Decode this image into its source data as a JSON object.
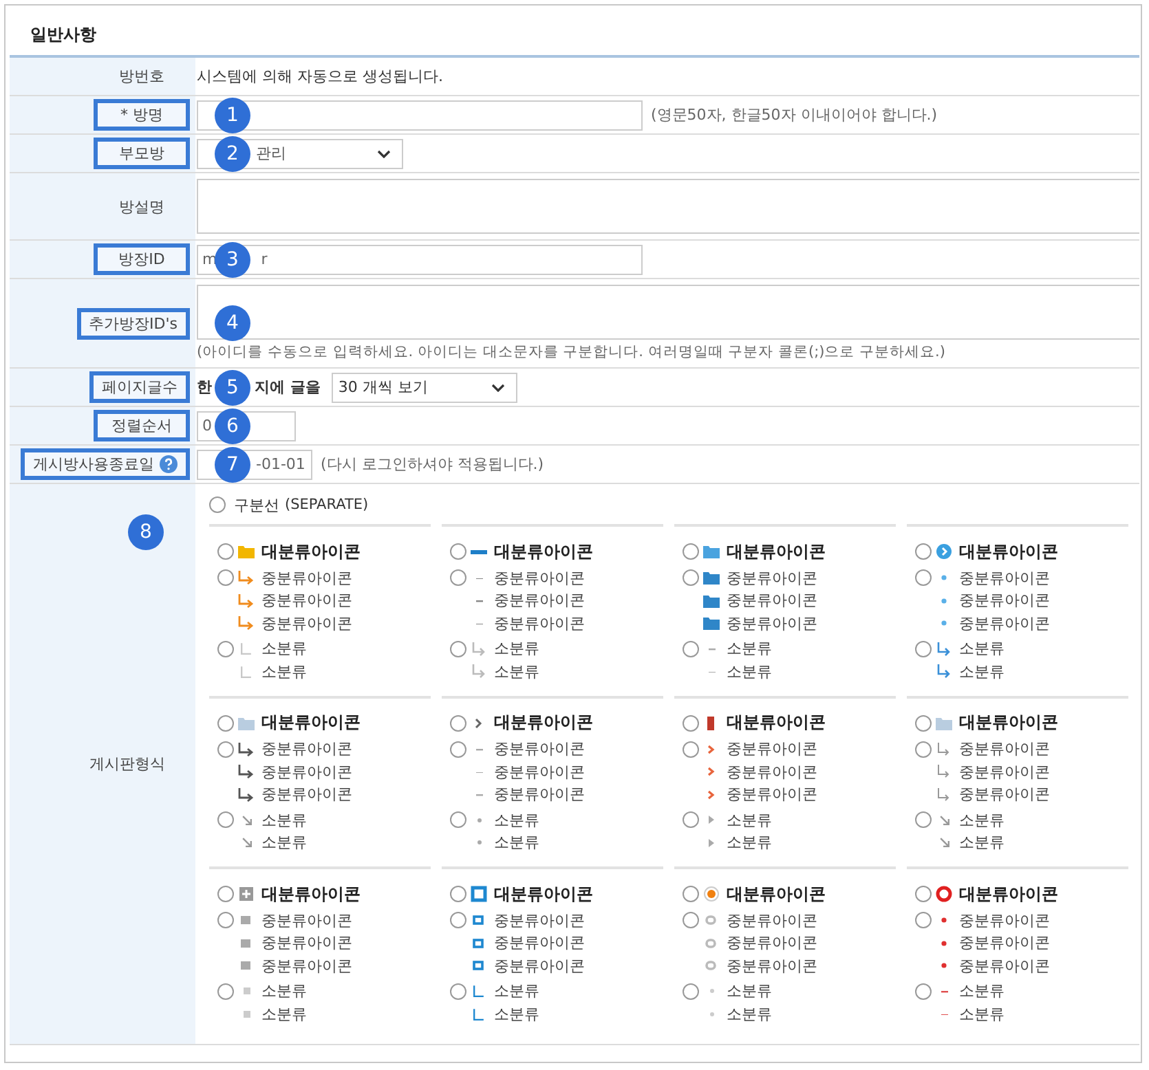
{
  "section_title": "일반사항",
  "rows": [
    {
      "label": "방번호",
      "highlighted": false,
      "kind": "static",
      "text": "시스템에 의해 자동으로 생성됩니다."
    },
    {
      "label": "* 방명",
      "highlighted": true,
      "badge": "1",
      "kind": "input",
      "hint": "(영문50자, 한글50자 이내이어야 합니다.)"
    },
    {
      "label": "부모방",
      "highlighted": true,
      "badge": "2",
      "kind": "select",
      "covered_start": true,
      "value_parts": [
        "관리"
      ]
    },
    {
      "label": "방설명",
      "highlighted": false,
      "kind": "textarea"
    },
    {
      "label": "방장ID",
      "highlighted": true,
      "badge": "3",
      "kind": "input",
      "value_parts": [
        "m",
        "r"
      ]
    },
    {
      "label": "추가방장ID's",
      "highlighted": true,
      "badge": "4",
      "kind": "textarea",
      "hint": "(아이디를 수동으로 입력하세요. 아이디는 대소문자를 구분합니다. 여러명일때 구분자 콜론(;)으로 구분하세요.)"
    },
    {
      "label": "페이지글수",
      "highlighted": true,
      "badge": "5",
      "kind": "page_count",
      "value_parts": [
        "한",
        "지에 글을"
      ],
      "select": "30 개씩 보기"
    },
    {
      "label": "정렬순서",
      "highlighted": true,
      "badge": "6",
      "kind": "short_input",
      "value_parts": [
        "0"
      ]
    },
    {
      "label": "게시방사용종료일",
      "highlighted": true,
      "help": true,
      "badge": "7",
      "kind": "date",
      "covered_start": true,
      "value_parts": [
        "-01-01"
      ],
      "hint": "(다시 로그인하셔야 적용됩니다.)"
    }
  ],
  "board_format": {
    "label": "게시판형식",
    "badge": "8",
    "separator": {
      "label": "구분선",
      "note": "(SEPARATE)",
      "selected": false
    },
    "groups": [
      {
        "major": {
          "label": "대분류아이콘",
          "selected": false
        },
        "middle": {
          "labels": [
            "중분류아이콘",
            "중분류아이콘",
            "중분류아이콘"
          ],
          "selected": false
        },
        "minor": {
          "labels": [
            "소분류",
            "소분류"
          ],
          "selected": false
        }
      },
      {
        "major": {
          "label": "대분류아이콘",
          "selected": false
        },
        "middle": {
          "labels": [
            "중분류아이콘",
            "중분류아이콘",
            "중분류아이콘"
          ],
          "selected": false
        },
        "minor": {
          "labels": [
            "소분류",
            "소분류"
          ],
          "selected": false
        }
      },
      {
        "major": {
          "label": "대분류아이콘",
          "selected": false
        },
        "middle": {
          "labels": [
            "중분류아이콘",
            "중분류아이콘",
            "중분류아이콘"
          ],
          "selected": false
        },
        "minor": {
          "labels": [
            "소분류",
            "소분류"
          ],
          "selected": false
        }
      },
      {
        "major": {
          "label": "대분류아이콘",
          "selected": false
        },
        "middle": {
          "labels": [
            "중분류아이콘",
            "중분류아이콘",
            "중분류아이콘"
          ],
          "selected": false
        },
        "minor": {
          "labels": [
            "소분류",
            "소분류"
          ],
          "selected": false
        }
      },
      {
        "major": {
          "label": "대분류아이콘",
          "selected": false
        },
        "middle": {
          "labels": [
            "중분류아이콘",
            "중분류아이콘",
            "중분류아이콘"
          ],
          "selected": false
        },
        "minor": {
          "labels": [
            "소분류",
            "소분류"
          ],
          "selected": false
        }
      },
      {
        "major": {
          "label": "대분류아이콘",
          "selected": false
        },
        "middle": {
          "labels": [
            "중분류아이콘",
            "중분류아이콘",
            "중분류아이콘"
          ],
          "selected": false
        },
        "minor": {
          "labels": [
            "소분류",
            "소분류"
          ],
          "selected": false
        }
      },
      {
        "major": {
          "label": "대분류아이콘",
          "selected": false
        },
        "middle": {
          "labels": [
            "중분류아이콘",
            "중분류아이콘",
            "중분류아이콘"
          ],
          "selected": false
        },
        "minor": {
          "labels": [
            "소분류",
            "소분류"
          ],
          "selected": false
        }
      },
      {
        "major": {
          "label": "대분류아이콘",
          "selected": false
        },
        "middle": {
          "labels": [
            "중분류아이콘",
            "중분류아이콘",
            "중분류아이콘"
          ],
          "selected": false
        },
        "minor": {
          "labels": [
            "소분류",
            "소분류"
          ],
          "selected": false
        }
      },
      {
        "major": {
          "label": "대분류아이콘",
          "selected": false
        },
        "middle": {
          "labels": [
            "중분류아이콘",
            "중분류아이콘",
            "중분류아이콘"
          ],
          "selected": false
        },
        "minor": {
          "labels": [
            "소분류",
            "소분류"
          ],
          "selected": false
        }
      },
      {
        "major": {
          "label": "대분류아이콘",
          "selected": false
        },
        "middle": {
          "labels": [
            "중분류아이콘",
            "중분류아이콘",
            "중분류아이콘"
          ],
          "selected": false
        },
        "minor": {
          "labels": [
            "소분류",
            "소분류"
          ],
          "selected": false
        }
      },
      {
        "major": {
          "label": "대분류아이콘",
          "selected": false
        },
        "middle": {
          "labels": [
            "중분류아이콘",
            "중분류아이콘",
            "중분류아이콘"
          ],
          "selected": false
        },
        "minor": {
          "labels": [
            "소분류",
            "소분류"
          ],
          "selected": false
        }
      },
      {
        "major": {
          "label": "대분류아이콘",
          "selected": false
        },
        "middle": {
          "labels": [
            "중분류아이콘",
            "중분류아이콘",
            "중분류아이콘"
          ],
          "selected": false
        },
        "minor": {
          "labels": [
            "소분류",
            "소분류"
          ],
          "selected": false
        }
      }
    ]
  }
}
